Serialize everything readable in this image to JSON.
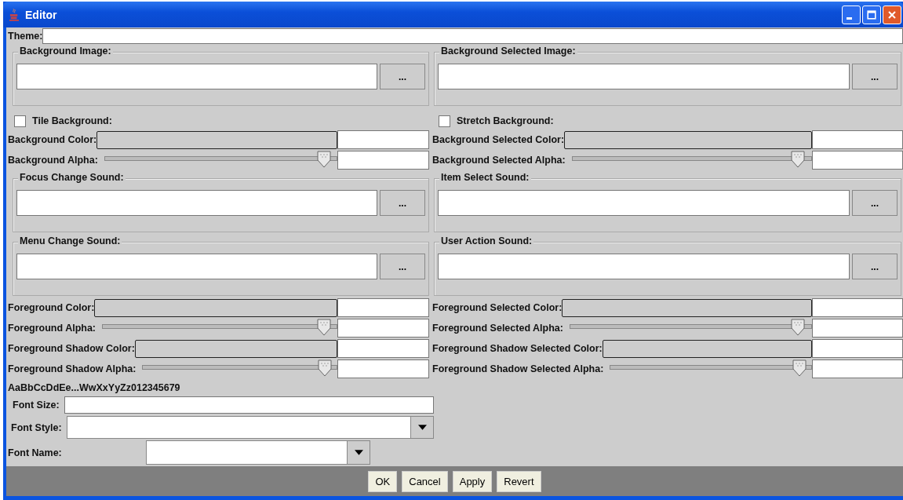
{
  "window": {
    "title": "Editor"
  },
  "theme": {
    "label": "Theme:"
  },
  "rows": [
    {
      "kind": "file",
      "cells": [
        {
          "title": "Background Image:",
          "button": "..."
        },
        {
          "title": "Background Selected Image:",
          "button": "..."
        }
      ]
    },
    {
      "kind": "checkbox",
      "cells": [
        {
          "label": "Tile Background:",
          "checked": false
        },
        {
          "label": "Stretch Background:",
          "checked": false
        }
      ]
    },
    {
      "kind": "color",
      "cells": [
        {
          "label": "Background Color:"
        },
        {
          "label": "Background Selected Color:"
        }
      ]
    },
    {
      "kind": "slider",
      "cells": [
        {
          "label": "Background Alpha:",
          "level": 0.97
        },
        {
          "label": "Background Selected Alpha:",
          "level": 0.97
        }
      ]
    },
    {
      "kind": "file",
      "cells": [
        {
          "title": "Focus Change Sound:",
          "button": "..."
        },
        {
          "title": "Item Select Sound:",
          "button": "..."
        }
      ]
    },
    {
      "kind": "file",
      "cells": [
        {
          "title": "Menu Change Sound:",
          "button": "..."
        },
        {
          "title": "User Action Sound:",
          "button": "..."
        }
      ]
    },
    {
      "kind": "color",
      "cells": [
        {
          "label": "Foreground Color:"
        },
        {
          "label": "Foreground Selected Color:"
        }
      ]
    },
    {
      "kind": "slider",
      "cells": [
        {
          "label": "Foreground Alpha:",
          "level": 0.97
        },
        {
          "label": "Foreground Selected Alpha:",
          "level": 0.97
        }
      ]
    },
    {
      "kind": "color",
      "cells": [
        {
          "label": "Foreground Shadow Color:"
        },
        {
          "label": "Foreground Shadow Selected Color:"
        }
      ]
    },
    {
      "kind": "slider",
      "cells": [
        {
          "label": "Foreground Shadow Alpha:",
          "level": 0.97
        },
        {
          "label": "Foreground Shadow Selected Alpha:",
          "level": 0.97
        }
      ]
    }
  ],
  "font": {
    "sample": "AaBbCcDdEe...WwXxYyZz012345679",
    "size_label": "Font Size:",
    "style_label": "Font Style:",
    "name_label": "Font Name:"
  },
  "buttons": [
    "OK",
    "Cancel",
    "Apply",
    "Revert"
  ]
}
